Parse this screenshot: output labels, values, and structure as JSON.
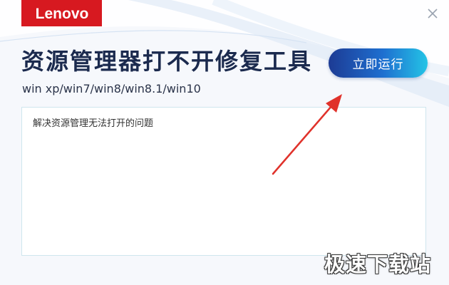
{
  "app": {
    "logo_text": "Lenovo",
    "title": "资源管理器打不开修复工具",
    "subtitle": "win xp/win7/win8/win8.1/win10",
    "description": "解决资源管理无法打开的问题",
    "run_button_label": "立即运行",
    "close_icon": "close-icon"
  },
  "watermark": {
    "text": "极速下载站"
  },
  "colors": {
    "brand_red": "#d71920",
    "title_navy": "#1b2a4e",
    "button_start": "#1d3b94",
    "button_end": "#24c4e6",
    "arrow_red": "#e0322b",
    "background": "#f6f8fc"
  }
}
